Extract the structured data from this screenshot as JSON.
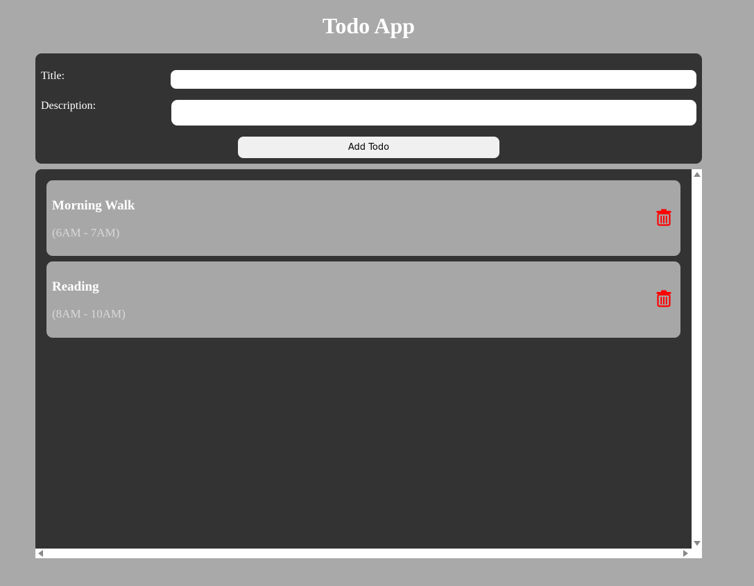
{
  "app": {
    "title": "Todo App"
  },
  "form": {
    "title_label": "Title:",
    "title_value": "",
    "description_label": "Description:",
    "description_value": "",
    "add_button_label": "Add Todo"
  },
  "todos": [
    {
      "title": "Morning Walk",
      "description": "(6AM - 7AM)",
      "delete_icon": "trash-icon"
    },
    {
      "title": "Reading",
      "description": "(8AM - 10AM)",
      "delete_icon": "trash-icon"
    }
  ],
  "colors": {
    "page_background": "#a9a9a9",
    "panel_background": "#333333",
    "card_background": "#a7a7a7",
    "delete_icon": "#ff0000"
  }
}
